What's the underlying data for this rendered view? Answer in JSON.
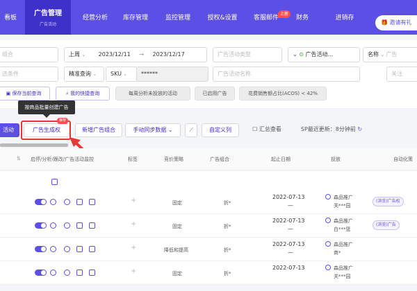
{
  "nav": {
    "items": [
      {
        "label": "看板"
      },
      {
        "label": "广告管理",
        "sub": "广告活动"
      },
      {
        "label": "经营分析"
      },
      {
        "label": "库存管理"
      },
      {
        "label": "监控管理"
      },
      {
        "label": "授权&设置"
      },
      {
        "label": "客服邮件"
      },
      {
        "label": "财务"
      },
      {
        "label": "进销存"
      }
    ],
    "new_badge": "上新",
    "invite_label": "邀请有礼"
  },
  "filters": {
    "f1": "组合",
    "period": "上周",
    "date_from": "2023/12/11",
    "date_sep": "→",
    "date_to": "2023/12/17",
    "campaign_type_ph": "广告活动类型",
    "status": "广告活动...",
    "name_sel": "名称",
    "name_ph": "广告",
    "f2": "选条件",
    "exact": "精准查询",
    "sku_label": "SKU",
    "sku_value": "******",
    "campaign_name_ph": "广告活动名称",
    "relate": "关注"
  },
  "quick": {
    "save_query": "保存当前查询",
    "my_queries": "我的快捷查询",
    "chip1": "每周分析未投放的活动",
    "chip2": "已启用广告",
    "chip3": "花费销售额占比(ACOS) < 42%"
  },
  "tooltip": "按商品批量创建广告",
  "toolbar": {
    "campaign": "活动",
    "generate": "广告生成权",
    "hot_badge": "推荐",
    "new_group": "新增广告组合",
    "sync": "手动同步数据",
    "custom_col": "自定义列",
    "summary": "汇总查看",
    "sp_update": "SP最近更新：8分钟前"
  },
  "table": {
    "headers": {
      "state": "启停/分析/跟改/广告活动监控",
      "tag": "标签",
      "bid": "竞价策略",
      "group": "广告组合",
      "start": "起止日期",
      "delivery": "投放",
      "auto": "自动化策"
    },
    "rows": [
      {
        "bid": "固定",
        "group": "折*",
        "start": "2022-07-13",
        "end": "—",
        "shop": "森品推广",
        "shop_sub": "关***园",
        "tag": "(浏览)广告权"
      },
      {
        "bid": "固定",
        "group": "折*",
        "start": "2022-07-13",
        "end": "—",
        "shop": "森品推广",
        "shop_sub": "白***篮",
        "tag": "(浏览)广告"
      },
      {
        "bid": "降低和提高",
        "group": "折*",
        "start": "2022-07-13",
        "end": "—",
        "shop": "森品推广",
        "shop_sub": "商*",
        "tag": ""
      },
      {
        "bid": "固定",
        "group": "折*",
        "start": "2022-07-13",
        "end": "",
        "shop": "森品推广",
        "shop_sub": "关***园",
        "tag": ""
      }
    ]
  },
  "colors": {
    "primary": "#5b4fe6",
    "primary_dark": "#3d31c9",
    "alert": "#e53935"
  }
}
